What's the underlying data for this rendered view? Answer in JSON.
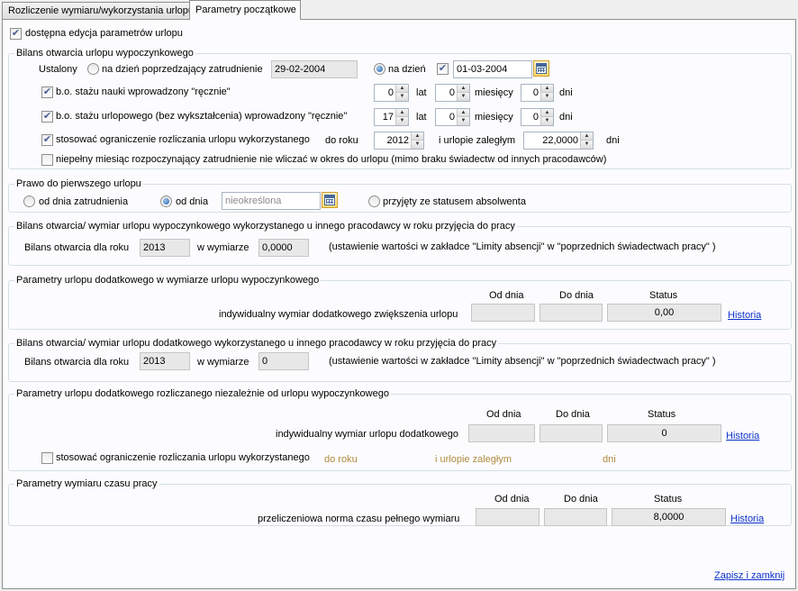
{
  "tabs": [
    {
      "label": "Rozliczenie wymiaru/wykorzystania urlopu",
      "active": false
    },
    {
      "label": "Parametry początkowe",
      "active": true
    }
  ],
  "editable": {
    "label": "dostępna edycja parametrów urlopu",
    "checked": true
  },
  "bilans": {
    "legend": "Bilans otwarcia urlopu wypoczynkowego",
    "ustalony_label": "Ustalony",
    "radio_prev_label": "na dzień poprzedzający zatrudnienie",
    "radio_prev_date": "29-02-2004",
    "radio_day_label": "na dzień",
    "day_date": "01-03-2004",
    "nauka": {
      "label": "b.o. stażu nauki wprowadzony \"ręcznie\"",
      "lat": "0",
      "miesiecy": "0",
      "dni": "0"
    },
    "urlopowy": {
      "label": "b.o. stażu urlopowego (bez wykształcenia) wprowadzony \"ręcznie\"",
      "lat": "17",
      "miesiecy": "0",
      "dni": "0"
    },
    "lat_label": "lat",
    "miesiecy_label": "miesięcy",
    "dni_label": "dni",
    "ograniczenie": {
      "label": "stosować ograniczenie rozliczania urlopu wykorzystanego",
      "do_roku_label": "do roku",
      "do_roku": "2012",
      "zaleglym_label": "i urlopie zaległym",
      "zaleglym": "22,0000",
      "dni_label": "dni"
    },
    "niepelny": {
      "label": "niepełny miesiąc rozpoczynający zatrudnienie nie wliczać w okres do urlopu (mimo braku świadectw od innych pracodawców)",
      "checked": false
    }
  },
  "prawo": {
    "legend": "Prawo do pierwszego urlopu",
    "od_zatrudnienia": "od dnia zatrudnienia",
    "od_dnia": "od dnia",
    "od_dnia_placeholder": "nieokreślona",
    "absolwent": "przyjęty ze statusem absolwenta"
  },
  "bilans_wymiar": {
    "legend": "Bilans otwarcia/ wymiar urlopu wypoczynkowego wykorzystanego u innego pracodawcy w roku przyjęcia do pracy",
    "label": "Bilans otwarcia  dla roku",
    "rok": "2013",
    "wymiarze_label": "w wymiarze",
    "wymiar": "0,0000",
    "note": "(ustawienie wartości w zakładce \"Limity absencji\" w \"poprzednich świadectwach pracy\" )"
  },
  "dodatkowy": {
    "legend": "Parametry urlopu dodatkowego w wymiarze urlopu wypoczynkowego",
    "od": "Od dnia",
    "do": "Do dnia",
    "status": "Status",
    "row_label": "indywidualny wymiar dodatkowego zwiększenia urlopu",
    "status_value": "0,00",
    "historia": "Historia"
  },
  "bilans_dodatkowy": {
    "legend": "Bilans otwarcia/ wymiar urlopu dodatkowego wykorzystanego u innego pracodawcy w roku przyjęcia do pracy",
    "label": "Bilans otwarcia  dla roku",
    "rok": "2013",
    "wymiarze_label": "w wymiarze",
    "wymiar": "0",
    "note": "(ustawienie wartości w zakładce \"Limity absencji\" w \"poprzednich świadectwach pracy\" )"
  },
  "niezaleznie": {
    "legend": "Parametry urlopu dodatkowego rozliczanego niezależnie od urlopu wypoczynkowego",
    "od": "Od dnia",
    "do": "Do dnia",
    "status": "Status",
    "row_label": "indywidualny wymiar urlopu dodatkowego",
    "status_value": "0",
    "historia": "Historia",
    "ogr_label": "stosować ograniczenie rozliczania urlopu wykorzystanego",
    "do_roku": "do roku",
    "zaleglym": "i urlopie zaległym",
    "dni": "dni"
  },
  "czas": {
    "legend": "Parametry wymiaru czasu pracy",
    "od": "Od dnia",
    "do": "Do dnia",
    "status": "Status",
    "row_label": "przeliczeniowa norma czasu pełnego wymiaru",
    "status_value": "8,0000",
    "historia": "Historia"
  },
  "footer": {
    "save": "Zapisz i zamknij"
  }
}
